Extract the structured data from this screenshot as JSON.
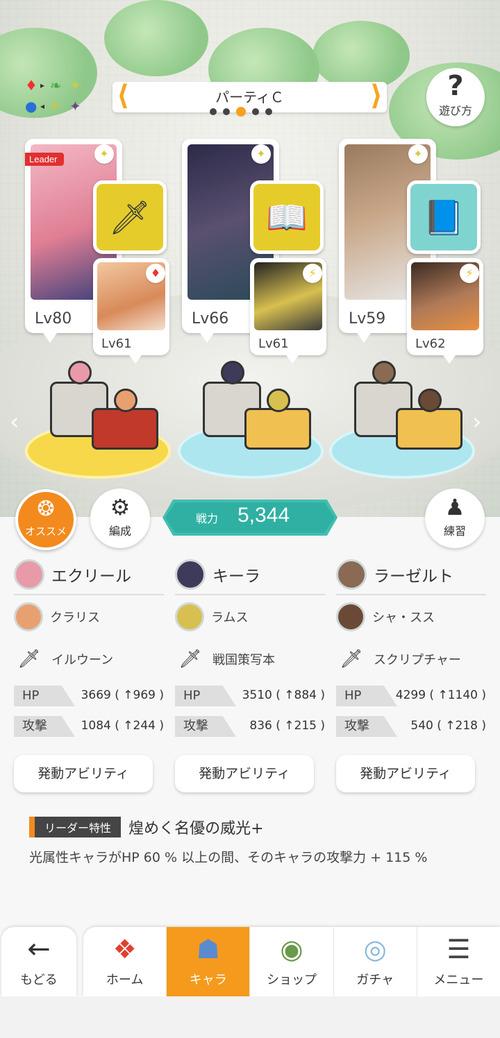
{
  "party": {
    "name": "パーティＣ",
    "page_count": 5,
    "current_page": 3
  },
  "help_label": "遊び方",
  "leader_tag": "Leader",
  "slots": [
    {
      "main_lv": "Lv80",
      "sub_lv": "Lv61",
      "main_color": "#e89aa8",
      "sub_color": "#e9a070",
      "equip_icon": "sword-icon",
      "equip_bg": "#e6cc2a",
      "main_element": "light",
      "sub_element": "fire"
    },
    {
      "main_lv": "Lv66",
      "sub_lv": "Lv61",
      "main_color": "#3d3a5a",
      "sub_color": "#d8c050",
      "equip_icon": "book-icon",
      "equip_bg": "#e6cc2a",
      "main_element": "light",
      "sub_element": "thunder"
    },
    {
      "main_lv": "Lv59",
      "sub_lv": "Lv62",
      "main_color": "#8a6a52",
      "sub_color": "#6a4a36",
      "equip_icon": "scripture-icon",
      "equip_bg": "#7fd4d0",
      "main_element": "light",
      "sub_element": "thunder"
    }
  ],
  "buttons": {
    "recommend": "オススメ",
    "formation": "編成",
    "practice": "練習"
  },
  "power": {
    "label": "戦力",
    "value": "5,344"
  },
  "columns": [
    {
      "leader": "エクリール",
      "sub": "クラリス",
      "equip": "イルウーン",
      "hp_label": "HP",
      "hp": "3669 ( ↑969 )",
      "atk_label": "攻撃",
      "atk": "1084 ( ↑244 )",
      "ability": "発動アビリティ"
    },
    {
      "leader": "キーラ",
      "sub": "ラムス",
      "equip": "戦国策写本",
      "hp_label": "HP",
      "hp": "3510 ( ↑884 )",
      "atk_label": "攻撃",
      "atk": "836 ( ↑215 )",
      "ability": "発動アビリティ"
    },
    {
      "leader": "ラーゼルト",
      "sub": "シャ・スス",
      "equip": "スクリプチャー",
      "hp_label": "HP",
      "hp": "4299 ( ↑1140 )",
      "atk_label": "攻撃",
      "atk": "540 ( ↑218 )",
      "ability": "発動アビリティ"
    }
  ],
  "leader_skill": {
    "tag": "リーダー特性",
    "title": "煌めく名優の威光+",
    "desc": "光属性キャラがHP 60 % 以上の間、そのキャラの攻撃力 + 115 %"
  },
  "nav": {
    "back": "もどる",
    "home": "ホーム",
    "chara": "キャラ",
    "shop": "ショップ",
    "gacha": "ガチャ",
    "menu": "メニュー"
  }
}
